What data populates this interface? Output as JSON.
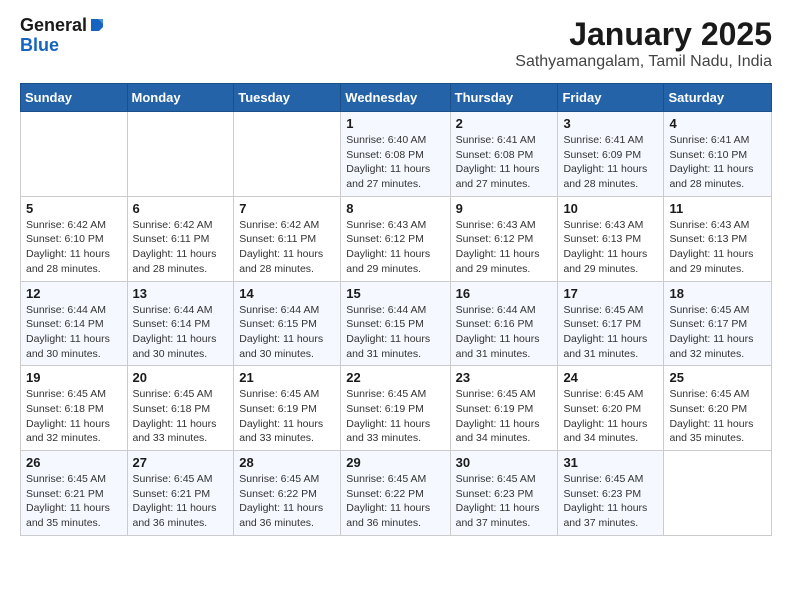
{
  "header": {
    "logo_line1": "General",
    "logo_line2": "Blue",
    "title": "January 2025",
    "subtitle": "Sathyamangalam, Tamil Nadu, India"
  },
  "days_of_week": [
    "Sunday",
    "Monday",
    "Tuesday",
    "Wednesday",
    "Thursday",
    "Friday",
    "Saturday"
  ],
  "weeks": [
    [
      {
        "day": "",
        "info": ""
      },
      {
        "day": "",
        "info": ""
      },
      {
        "day": "",
        "info": ""
      },
      {
        "day": "1",
        "info": "Sunrise: 6:40 AM\nSunset: 6:08 PM\nDaylight: 11 hours and 27 minutes."
      },
      {
        "day": "2",
        "info": "Sunrise: 6:41 AM\nSunset: 6:08 PM\nDaylight: 11 hours and 27 minutes."
      },
      {
        "day": "3",
        "info": "Sunrise: 6:41 AM\nSunset: 6:09 PM\nDaylight: 11 hours and 28 minutes."
      },
      {
        "day": "4",
        "info": "Sunrise: 6:41 AM\nSunset: 6:10 PM\nDaylight: 11 hours and 28 minutes."
      }
    ],
    [
      {
        "day": "5",
        "info": "Sunrise: 6:42 AM\nSunset: 6:10 PM\nDaylight: 11 hours and 28 minutes."
      },
      {
        "day": "6",
        "info": "Sunrise: 6:42 AM\nSunset: 6:11 PM\nDaylight: 11 hours and 28 minutes."
      },
      {
        "day": "7",
        "info": "Sunrise: 6:42 AM\nSunset: 6:11 PM\nDaylight: 11 hours and 28 minutes."
      },
      {
        "day": "8",
        "info": "Sunrise: 6:43 AM\nSunset: 6:12 PM\nDaylight: 11 hours and 29 minutes."
      },
      {
        "day": "9",
        "info": "Sunrise: 6:43 AM\nSunset: 6:12 PM\nDaylight: 11 hours and 29 minutes."
      },
      {
        "day": "10",
        "info": "Sunrise: 6:43 AM\nSunset: 6:13 PM\nDaylight: 11 hours and 29 minutes."
      },
      {
        "day": "11",
        "info": "Sunrise: 6:43 AM\nSunset: 6:13 PM\nDaylight: 11 hours and 29 minutes."
      }
    ],
    [
      {
        "day": "12",
        "info": "Sunrise: 6:44 AM\nSunset: 6:14 PM\nDaylight: 11 hours and 30 minutes."
      },
      {
        "day": "13",
        "info": "Sunrise: 6:44 AM\nSunset: 6:14 PM\nDaylight: 11 hours and 30 minutes."
      },
      {
        "day": "14",
        "info": "Sunrise: 6:44 AM\nSunset: 6:15 PM\nDaylight: 11 hours and 30 minutes."
      },
      {
        "day": "15",
        "info": "Sunrise: 6:44 AM\nSunset: 6:15 PM\nDaylight: 11 hours and 31 minutes."
      },
      {
        "day": "16",
        "info": "Sunrise: 6:44 AM\nSunset: 6:16 PM\nDaylight: 11 hours and 31 minutes."
      },
      {
        "day": "17",
        "info": "Sunrise: 6:45 AM\nSunset: 6:17 PM\nDaylight: 11 hours and 31 minutes."
      },
      {
        "day": "18",
        "info": "Sunrise: 6:45 AM\nSunset: 6:17 PM\nDaylight: 11 hours and 32 minutes."
      }
    ],
    [
      {
        "day": "19",
        "info": "Sunrise: 6:45 AM\nSunset: 6:18 PM\nDaylight: 11 hours and 32 minutes."
      },
      {
        "day": "20",
        "info": "Sunrise: 6:45 AM\nSunset: 6:18 PM\nDaylight: 11 hours and 33 minutes."
      },
      {
        "day": "21",
        "info": "Sunrise: 6:45 AM\nSunset: 6:19 PM\nDaylight: 11 hours and 33 minutes."
      },
      {
        "day": "22",
        "info": "Sunrise: 6:45 AM\nSunset: 6:19 PM\nDaylight: 11 hours and 33 minutes."
      },
      {
        "day": "23",
        "info": "Sunrise: 6:45 AM\nSunset: 6:19 PM\nDaylight: 11 hours and 34 minutes."
      },
      {
        "day": "24",
        "info": "Sunrise: 6:45 AM\nSunset: 6:20 PM\nDaylight: 11 hours and 34 minutes."
      },
      {
        "day": "25",
        "info": "Sunrise: 6:45 AM\nSunset: 6:20 PM\nDaylight: 11 hours and 35 minutes."
      }
    ],
    [
      {
        "day": "26",
        "info": "Sunrise: 6:45 AM\nSunset: 6:21 PM\nDaylight: 11 hours and 35 minutes."
      },
      {
        "day": "27",
        "info": "Sunrise: 6:45 AM\nSunset: 6:21 PM\nDaylight: 11 hours and 36 minutes."
      },
      {
        "day": "28",
        "info": "Sunrise: 6:45 AM\nSunset: 6:22 PM\nDaylight: 11 hours and 36 minutes."
      },
      {
        "day": "29",
        "info": "Sunrise: 6:45 AM\nSunset: 6:22 PM\nDaylight: 11 hours and 36 minutes."
      },
      {
        "day": "30",
        "info": "Sunrise: 6:45 AM\nSunset: 6:23 PM\nDaylight: 11 hours and 37 minutes."
      },
      {
        "day": "31",
        "info": "Sunrise: 6:45 AM\nSunset: 6:23 PM\nDaylight: 11 hours and 37 minutes."
      },
      {
        "day": "",
        "info": ""
      }
    ]
  ]
}
